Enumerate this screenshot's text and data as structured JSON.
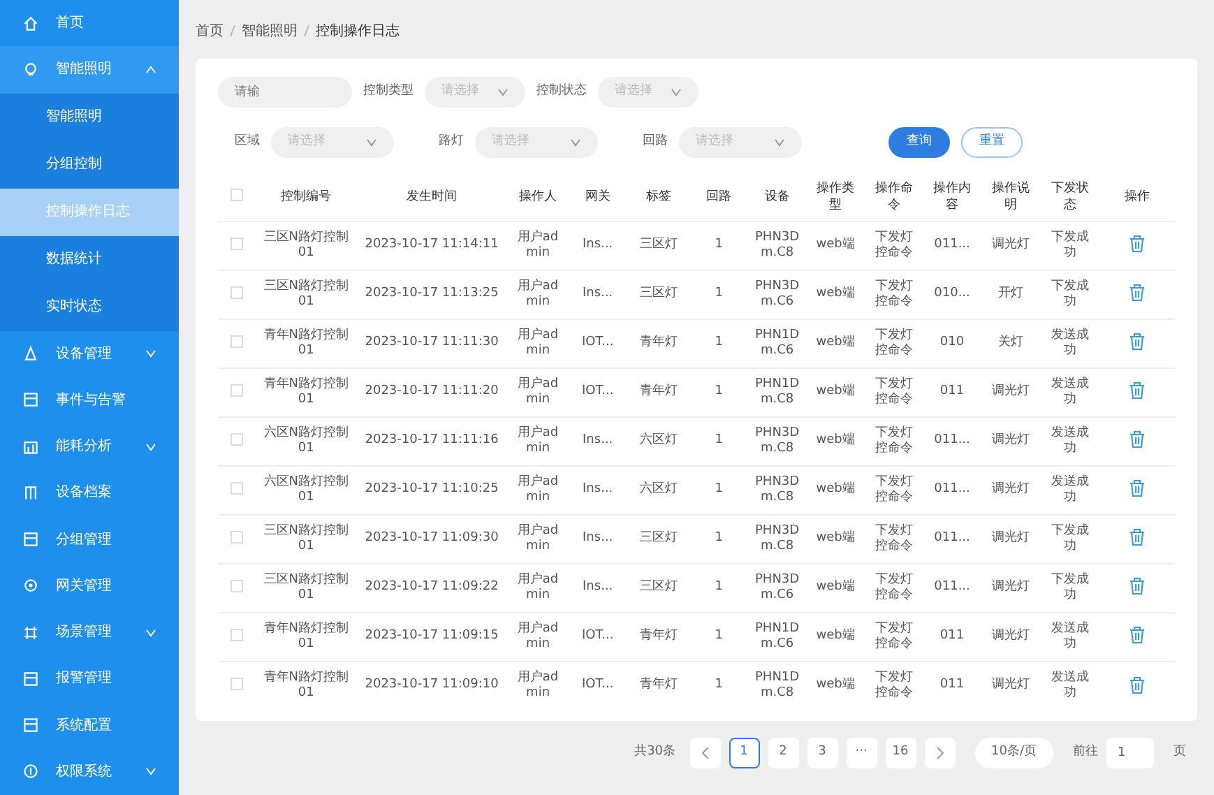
{
  "sidebar": {
    "items": [
      {
        "label": "首页",
        "selected": false
      },
      {
        "label": "智能照明",
        "selected": false,
        "expanded": true,
        "children": [
          {
            "label": "智能照明",
            "selected": false
          },
          {
            "label": "分组控制",
            "selected": false
          },
          {
            "label": "控制操作日志",
            "selected": true
          },
          {
            "label": "数据统计",
            "selected": false
          },
          {
            "label": "实时状态",
            "selected": false
          }
        ]
      },
      {
        "label": "设备管理",
        "selected": false,
        "expanded": false
      },
      {
        "label": "事件与告警",
        "selected": false
      },
      {
        "label": "能耗分析",
        "selected": false,
        "expanded": false
      },
      {
        "label": "设备档案",
        "selected": false
      },
      {
        "label": "分组管理",
        "selected": false
      },
      {
        "label": "网关管理",
        "selected": false
      },
      {
        "label": "场景管理",
        "selected": false,
        "expanded": false
      },
      {
        "label": "报警管理",
        "selected": false
      },
      {
        "label": "系统配置",
        "selected": false
      },
      {
        "label": "权限系统",
        "selected": false,
        "expanded": false
      }
    ]
  },
  "breadcrumb": [
    "首页",
    "智能照明",
    "控制操作日志"
  ],
  "filters": {
    "search": {
      "placeholder": "请输"
    },
    "row1": [
      {
        "label": "控制类型",
        "placeholder": "请选择"
      },
      {
        "label": "控制状态",
        "placeholder": "请选择"
      }
    ],
    "row2": [
      {
        "label": "区域",
        "placeholder": "请选择"
      },
      {
        "label": "路灯",
        "placeholder": "请选择"
      },
      {
        "label": "回路",
        "placeholder": "请选择"
      }
    ],
    "buttons": [
      {
        "label": "查询",
        "kind": "primary"
      },
      {
        "label": "重置",
        "kind": "plain"
      }
    ]
  },
  "table": {
    "all_checked": false,
    "columns": [
      "控制编号",
      "发生时间",
      "操作人",
      "网关",
      "标签",
      "回路",
      "设备",
      "操作类型",
      "操作命令",
      "操作内容",
      "操作说明",
      "下发状态",
      "操作"
    ],
    "rows": [
      {
        "checked": false,
        "cells": [
          "三区N路灯控制01",
          "2023-10-17 11:14:11",
          "用户admin",
          "Ins...",
          "三区灯",
          "1",
          "PHN3Dm.C8",
          "web端",
          "下发灯控命令",
          "011...",
          "调光灯",
          "下发成功"
        ]
      },
      {
        "checked": false,
        "cells": [
          "三区N路灯控制01",
          "2023-10-17 11:13:25",
          "用户admin",
          "Ins...",
          "三区灯",
          "1",
          "PHN3Dm.C6",
          "web端",
          "下发灯控命令",
          "010...",
          "开灯",
          "下发成功"
        ]
      },
      {
        "checked": false,
        "cells": [
          "青年N路灯控制01",
          "2023-10-17 11:11:30",
          "用户admin",
          "IOT...",
          "青年灯",
          "1",
          "PHN1Dm.C6",
          "web端",
          "下发灯控命令",
          "010",
          "关灯",
          "发送成功"
        ]
      },
      {
        "checked": false,
        "cells": [
          "青年N路灯控制01",
          "2023-10-17 11:11:20",
          "用户admin",
          "IOT...",
          "青年灯",
          "1",
          "PHN1Dm.C8",
          "web端",
          "下发灯控命令",
          "011",
          "调光灯",
          "发送成功"
        ]
      },
      {
        "checked": false,
        "cells": [
          "六区N路灯控制01",
          "2023-10-17 11:11:16",
          "用户admin",
          "Ins...",
          "六区灯",
          "1",
          "PHN3Dm.C8",
          "web端",
          "下发灯控命令",
          "011...",
          "调光灯",
          "发送成功"
        ]
      },
      {
        "checked": false,
        "cells": [
          "六区N路灯控制01",
          "2023-10-17 11:10:25",
          "用户admin",
          "Ins...",
          "六区灯",
          "1",
          "PHN3Dm.C8",
          "web端",
          "下发灯控命令",
          "011...",
          "调光灯",
          "发送成功"
        ]
      },
      {
        "checked": false,
        "cells": [
          "三区N路灯控制01",
          "2023-10-17 11:09:30",
          "用户admin",
          "Ins...",
          "三区灯",
          "1",
          "PHN3Dm.C8",
          "web端",
          "下发灯控命令",
          "011...",
          "调光灯",
          "下发成功"
        ]
      },
      {
        "checked": false,
        "cells": [
          "三区N路灯控制01",
          "2023-10-17 11:09:22",
          "用户admin",
          "Ins...",
          "三区灯",
          "1",
          "PHN3Dm.C6",
          "web端",
          "下发灯控命令",
          "011...",
          "调光灯",
          "下发成功"
        ]
      },
      {
        "checked": false,
        "cells": [
          "青年N路灯控制01",
          "2023-10-17 11:09:15",
          "用户admin",
          "IOT...",
          "青年灯",
          "1",
          "PHN1Dm.C6",
          "web端",
          "下发灯控命令",
          "011",
          "调光灯",
          "发送成功"
        ]
      },
      {
        "checked": false,
        "cells": [
          "青年N路灯控制01",
          "2023-10-17 11:09:10",
          "用户admin",
          "IOT...",
          "青年灯",
          "1",
          "PHN1Dm.C8",
          "web端",
          "下发灯控命令",
          "011",
          "调光灯",
          "发送成功"
        ]
      }
    ]
  },
  "pagination": {
    "total": "共30条",
    "pages": [
      {
        "label": "1",
        "selected": true
      },
      {
        "label": "2",
        "selected": false
      },
      {
        "label": "3",
        "selected": false
      },
      {
        "label": "···",
        "selected": false
      },
      {
        "label": "16",
        "selected": false
      }
    ],
    "page_size": "10条/页",
    "goto_label": "前往",
    "goto_value": "1",
    "goto_suffix": "页"
  }
}
